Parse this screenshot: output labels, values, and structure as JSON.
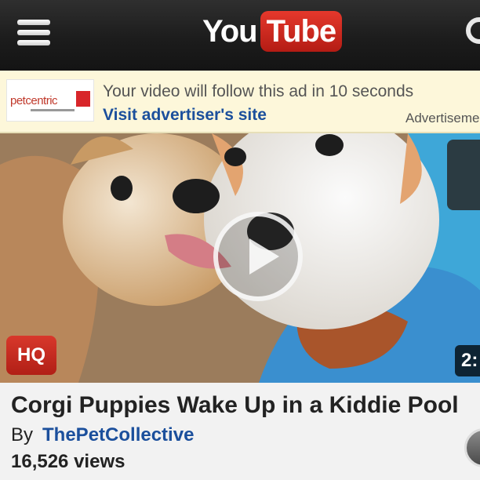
{
  "header": {
    "logo_you": "You",
    "logo_tube": "Tube",
    "menu_icon": "menu-icon",
    "search_icon": "search-icon"
  },
  "ad": {
    "advertiser_logo": "petcentric",
    "message": "Your video will follow this ad in 10 seconds",
    "link": "Visit advertiser's site",
    "label": "Advertisement"
  },
  "player": {
    "quality_badge": "HQ",
    "duration": "2:",
    "play_icon": "play-icon"
  },
  "video": {
    "title": "Corgi Puppies Wake Up in a Kiddie Pool",
    "by_label": "By",
    "channel": "ThePetCollective",
    "views": "16,526 views"
  },
  "colors": {
    "header_bg": "#1c1c1c",
    "logo_red": "#cc2a20",
    "ad_bg": "#fdf7da",
    "link_blue": "#1b4f9c",
    "hq_red": "#c62a1f"
  }
}
